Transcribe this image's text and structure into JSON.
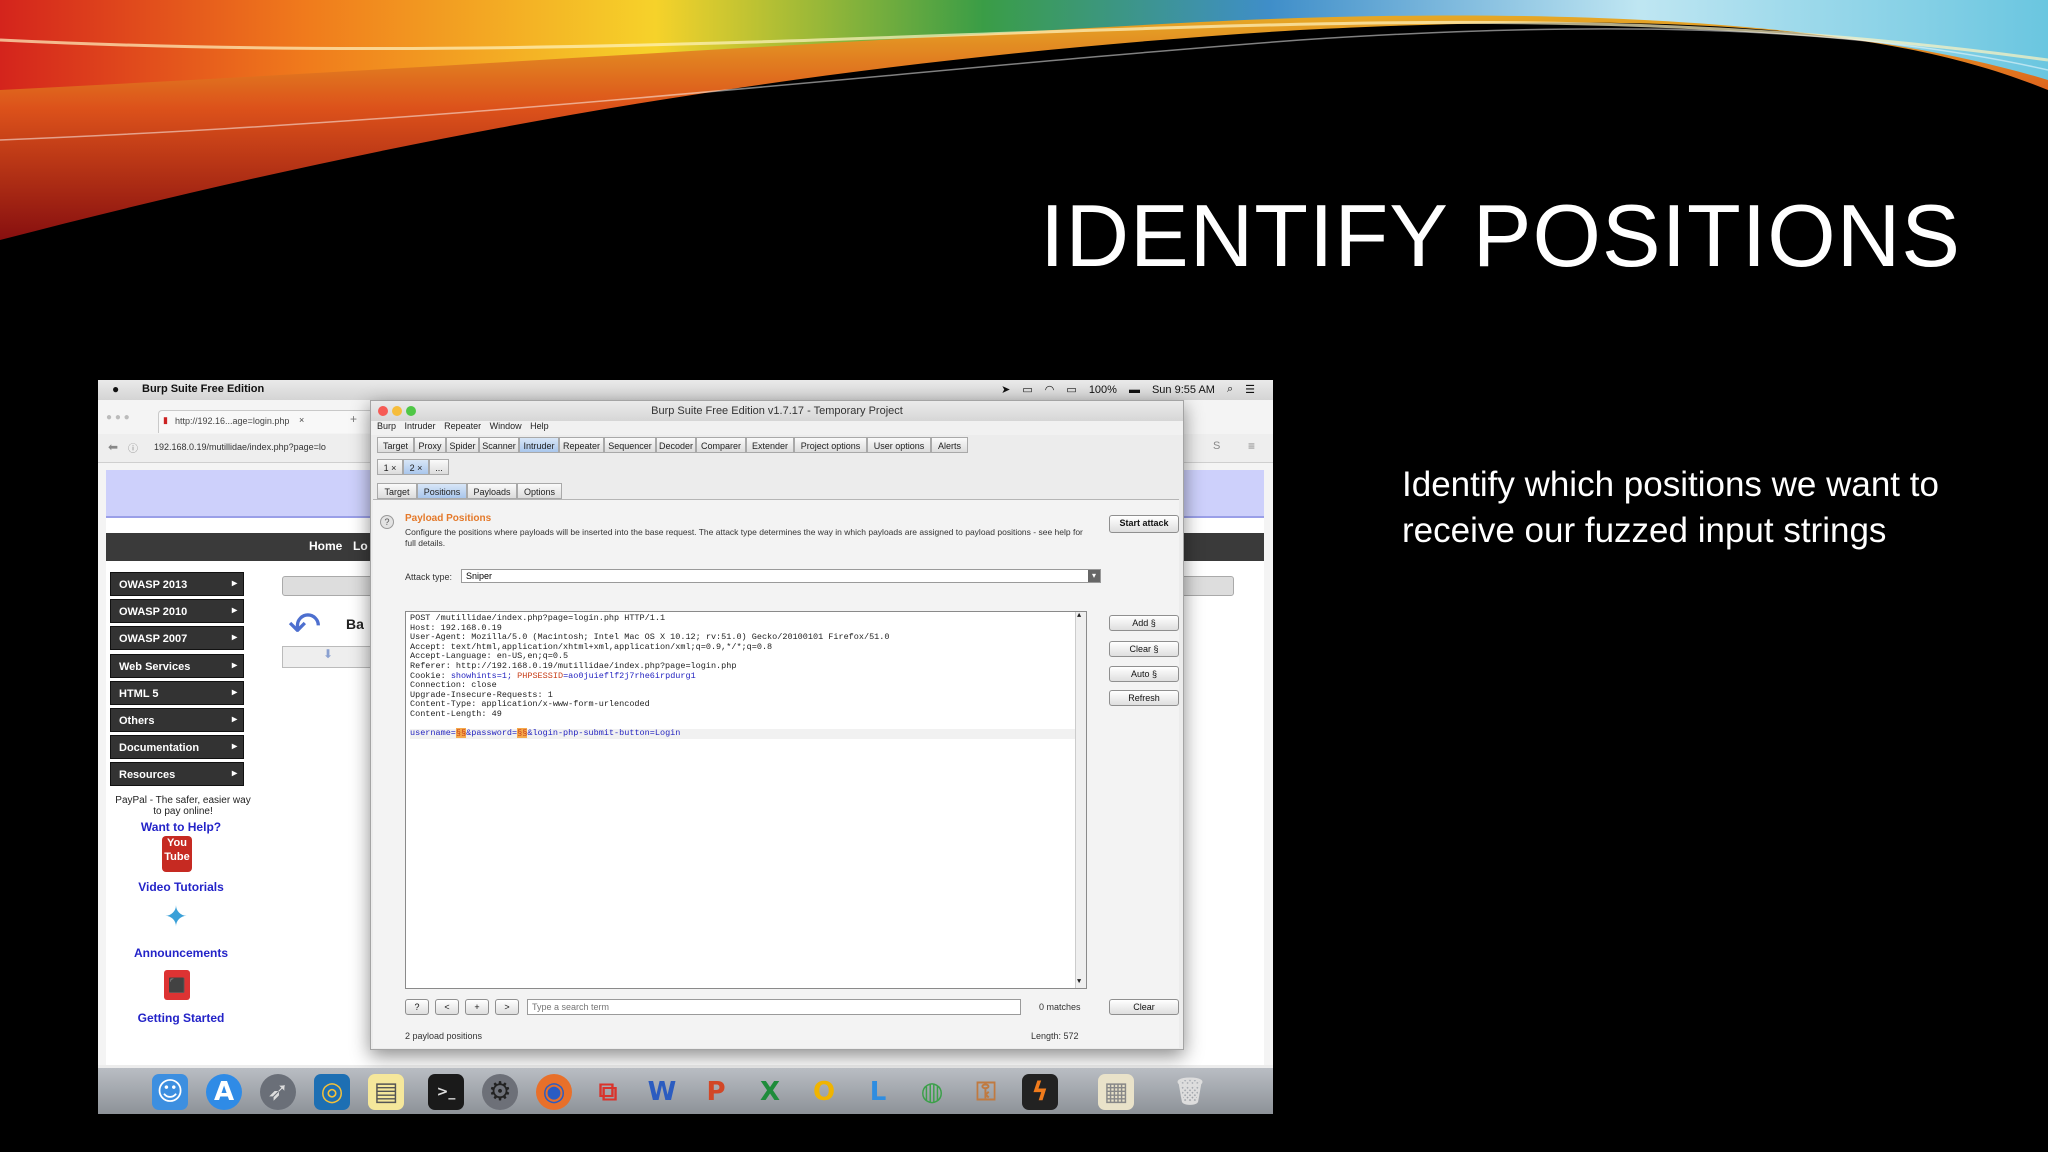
{
  "slide": {
    "title": "IDENTIFY POSITIONS",
    "body": "Identify which positions we want to receive our fuzzed input strings"
  },
  "macos": {
    "app_name": "Burp Suite Free Edition",
    "battery": "100%",
    "clock": "Sun 9:55 AM"
  },
  "browser": {
    "tab_title": "http://192.16...age=login.php",
    "url": "192.168.0.19/mutillidae/index.php?page=lo",
    "nav_home": "Home",
    "nav_cut": "Lo",
    "sidebar_items": [
      "OWASP 2013",
      "OWASP 2010",
      "OWASP 2007",
      "Web Services",
      "HTML 5",
      "Others",
      "Documentation",
      "Resources"
    ],
    "paypal_text": "PayPal - The safer, easier way to pay online!",
    "help_text": "Want to Help?",
    "links": [
      "Video Tutorials",
      "Announcements",
      "Getting Started"
    ],
    "back_cut": "Ba"
  },
  "burp": {
    "window_title": "Burp Suite Free Edition v1.7.17 - Temporary Project",
    "menu": [
      "Burp",
      "Intruder",
      "Repeater",
      "Window",
      "Help"
    ],
    "main_tabs": [
      "Target",
      "Proxy",
      "Spider",
      "Scanner",
      "Intruder",
      "Repeater",
      "Sequencer",
      "Decoder",
      "Comparer",
      "Extender",
      "Project options",
      "User options",
      "Alerts"
    ],
    "active_main_tab": "Intruder",
    "attack_tabs": [
      "1 ×",
      "2 ×",
      "..."
    ],
    "sub_tabs": [
      "Target",
      "Positions",
      "Payloads",
      "Options"
    ],
    "active_sub_tab": "Positions",
    "section_title": "Payload Positions",
    "section_desc": "Configure the positions where payloads will be inserted into the base request. The attack type determines the way in which payloads are assigned to payload positions - see help for full details.",
    "attack_type_label": "Attack type:",
    "attack_type_value": "Sniper",
    "start_attack": "Start attack",
    "side_buttons": [
      "Add §",
      "Clear §",
      "Auto §",
      "Refresh"
    ],
    "request_lines": [
      "POST /mutillidae/index.php?page=login.php HTTP/1.1",
      "Host: 192.168.0.19",
      "User-Agent: Mozilla/5.0 (Macintosh; Intel Mac OS X 10.12; rv:51.0) Gecko/20100101 Firefox/51.0",
      "Accept: text/html,application/xhtml+xml,application/xml;q=0.9,*/*;q=0.8",
      "Accept-Language: en-US,en;q=0.5",
      "Referer: http://192.168.0.19/mutillidae/index.php?page=login.php",
      "Connection: close",
      "Upgrade-Insecure-Requests: 1",
      "Content-Type: application/x-www-form-urlencoded",
      "Content-Length: 49"
    ],
    "cookie_key": "Cookie:",
    "cookie_part1": "showhints",
    "cookie_part1_val": "=1; ",
    "cookie_part2": "PHPSESSID",
    "cookie_part2_val": "=ao0juieflf2j7rhe6irpdurg1",
    "body_p1": "username=",
    "body_m1": "§§",
    "body_p2": "&password=",
    "body_m2": "§§",
    "body_p3": "&login-php-submit-button=Login",
    "search_nav": [
      "?",
      "<",
      "+",
      ">"
    ],
    "search_placeholder": "Type a search term",
    "matches": "0 matches",
    "clear": "Clear",
    "payload_positions": "2 payload positions",
    "length": "Length: 572"
  },
  "dock": [
    "finder",
    "app-store",
    "launchpad",
    "wireshark",
    "notes",
    "terminal",
    "system-preferences",
    "firefox",
    "parallels",
    "word",
    "powerpoint",
    "excel",
    "outlook",
    "lync",
    "network",
    "burp-suite",
    "preview",
    "trash"
  ]
}
